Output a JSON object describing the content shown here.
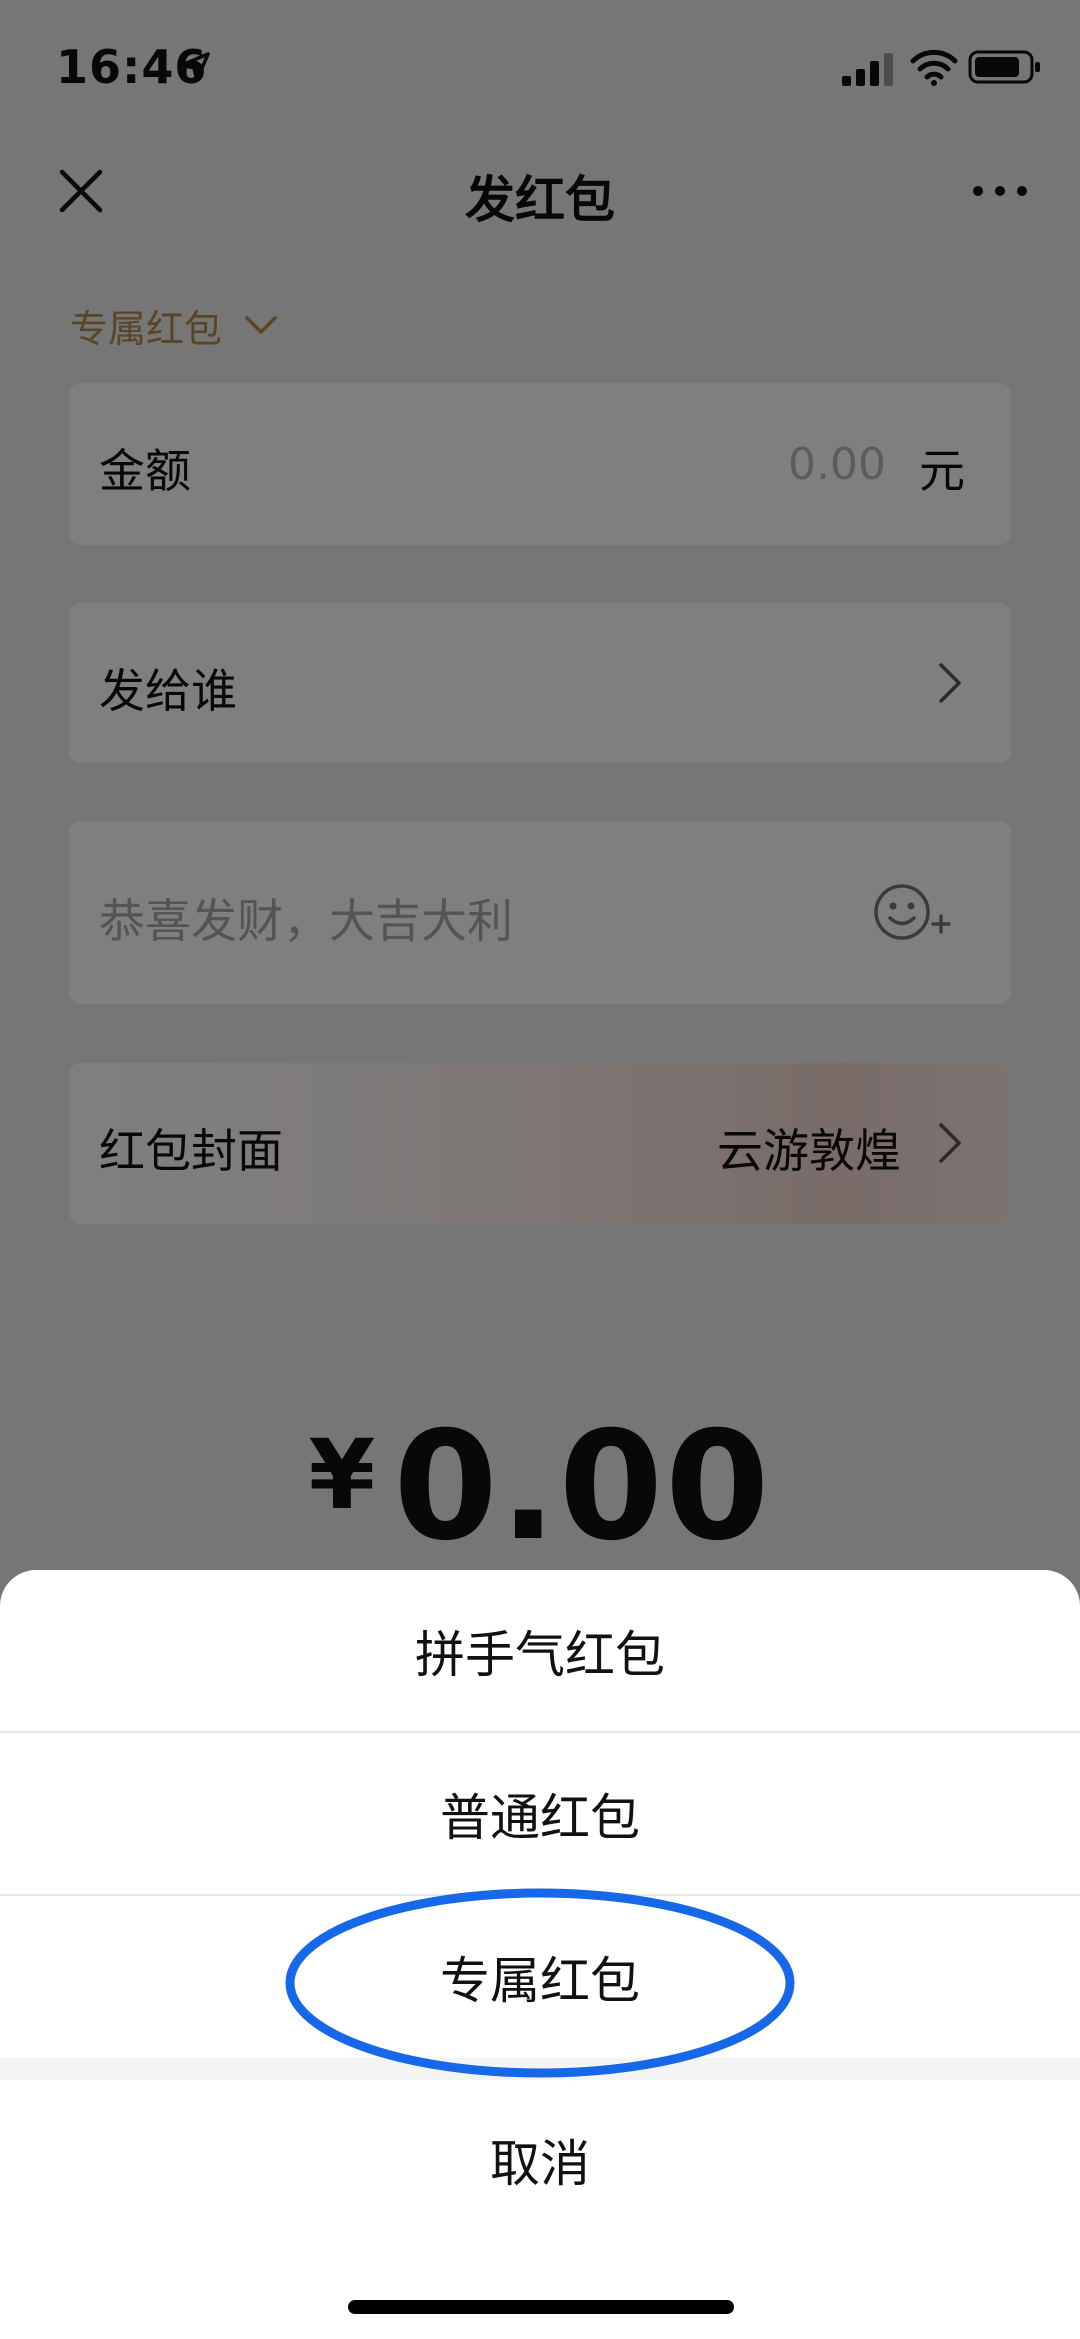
{
  "status_bar": {
    "time": "16:46",
    "icons": [
      "location-arrow-icon",
      "cellular-signal-icon",
      "wifi-icon",
      "battery-icon"
    ]
  },
  "nav": {
    "title": "发红包",
    "left_icon": "close-icon",
    "right_icon": "more-icon"
  },
  "form": {
    "type_label": "专属红包",
    "amount_label": "金额",
    "amount_value": "0.00",
    "amount_unit": "元",
    "recipient_label": "发给谁",
    "greeting_placeholder": "恭喜发财，大吉大利",
    "cover_label": "红包封面",
    "cover_value": "云游敦煌"
  },
  "total": {
    "currency": "¥",
    "value": "0.00"
  },
  "action_sheet": {
    "options": [
      "拼手气红包",
      "普通红包",
      "专属红包"
    ],
    "cancel": "取消",
    "highlighted_option": "专属红包"
  },
  "colors": {
    "accent_gold": "#b48a48",
    "highlight_blue": "#1668e8",
    "background": "#ededed"
  }
}
